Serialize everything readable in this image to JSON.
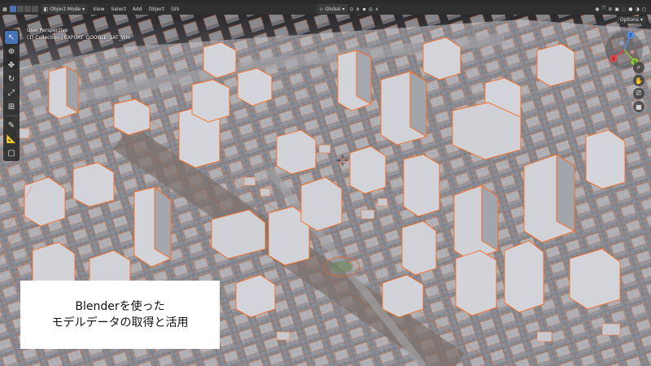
{
  "header": {
    "mode": "Object Mode",
    "menus": [
      "View",
      "Select",
      "Add",
      "Object",
      "GIS"
    ],
    "transform_orientation": "Global"
  },
  "viewport": {
    "perspective_label": "User Perspective",
    "collection_label": "(1) Collection | EXPORT_GOOGLE_SAT_WM",
    "options_label": "Options"
  },
  "gizmo": {
    "x": "X",
    "y": "Y",
    "z": "Z"
  },
  "caption": {
    "line1": "Blenderを使った",
    "line2": "モデルデータの取得と活用"
  },
  "colors": {
    "accent": "#4772b3",
    "building": "#c9cbd1",
    "outline": "#ff6a1a",
    "gizmo_x": "#e0484f",
    "gizmo_y": "#8cc63f",
    "gizmo_z": "#4f8fe6"
  }
}
